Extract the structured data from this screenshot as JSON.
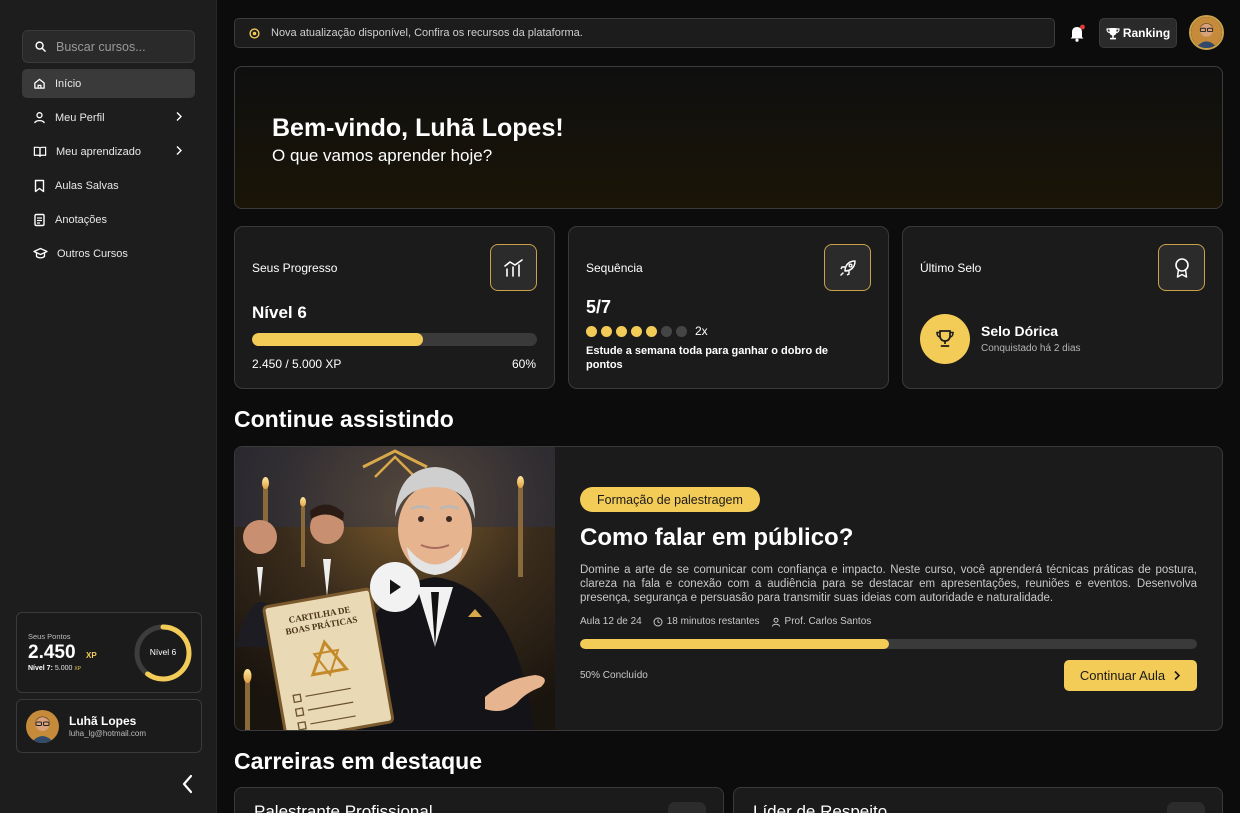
{
  "sidebar": {
    "search_placeholder": "Buscar cursos...",
    "nav": [
      {
        "label": "Início",
        "icon": "home-icon",
        "active": true
      },
      {
        "label": "Meu Perfil",
        "icon": "user-icon",
        "has_chevron": true
      },
      {
        "label": "Meu aprendizado",
        "icon": "book-icon",
        "has_chevron": true
      },
      {
        "label": "Aulas Salvas",
        "icon": "bookmark-icon"
      },
      {
        "label": "Anotações",
        "icon": "notes-icon"
      },
      {
        "label": "Outros Cursos",
        "icon": "graduation-cap-icon"
      }
    ],
    "points": {
      "label": "Seus Pontos",
      "value": "2.450",
      "unit": "XP",
      "next_level_label": "Nível 7:",
      "next_level_value": "5.000",
      "next_level_unit": "XP",
      "ring_label": "Nível 6",
      "ring_fraction": 0.6
    },
    "user": {
      "name": "Luhã Lopes",
      "email": "luha_lg@hotmail.com"
    }
  },
  "topbar": {
    "notice": "Nova atualização disponível, Confira os recursos da plataforma.",
    "ranking_label": "Ranking"
  },
  "welcome": {
    "title": "Bem-vindo, Luhã Lopes!",
    "subtitle": "O que vamos aprender hoje?"
  },
  "stats": {
    "progress": {
      "title": "Seus Progresso",
      "level": "Nível 6",
      "xp": "2.450 / 5.000 XP",
      "percent": "60%",
      "fraction": 0.6
    },
    "streak": {
      "title": "Sequência",
      "value": "5/7",
      "days_done": 5,
      "days_total": 7,
      "multiplier": "2x",
      "description": "Estude a semana toda para ganhar o dobro de pontos"
    },
    "badge": {
      "title": "Último Selo",
      "name": "Selo Dórica",
      "subtitle": "Conquistado há 2 dias"
    }
  },
  "continue_section": {
    "title": "Continue assistindo",
    "tag": "Formação de palestragem",
    "course_title": "Como falar em público?",
    "description": "Domine a arte de se comunicar com confiança e impacto. Neste curso, você aprenderá técnicas práticas de postura, clareza na fala e conexão com a audiência para se destacar em apresentações, reuniões e eventos. Desenvolva presença, segurança e persuasão para transmitir suas ideias com autoridade e naturalidade.",
    "lesson": "Aula 12 de 24",
    "remaining": "18 minutos restantes",
    "teacher": "Prof. Carlos Santos",
    "progress_fraction": 0.5,
    "progress_label": "50% Concluído",
    "button_label": "Continuar Aula",
    "thumbnail_text_line1": "CARTILHA DE",
    "thumbnail_text_line2": "BOAS PRÁTICAS"
  },
  "careers_section": {
    "title": "Carreiras em destaque",
    "items": [
      {
        "name": "Palestrante Profissional"
      },
      {
        "name": "Líder de Respeito"
      }
    ]
  },
  "colors": {
    "accent": "#f3cb57",
    "background": "#0c0c0c",
    "card": "#1b1b1b",
    "sidebar": "#1d1d1d"
  }
}
